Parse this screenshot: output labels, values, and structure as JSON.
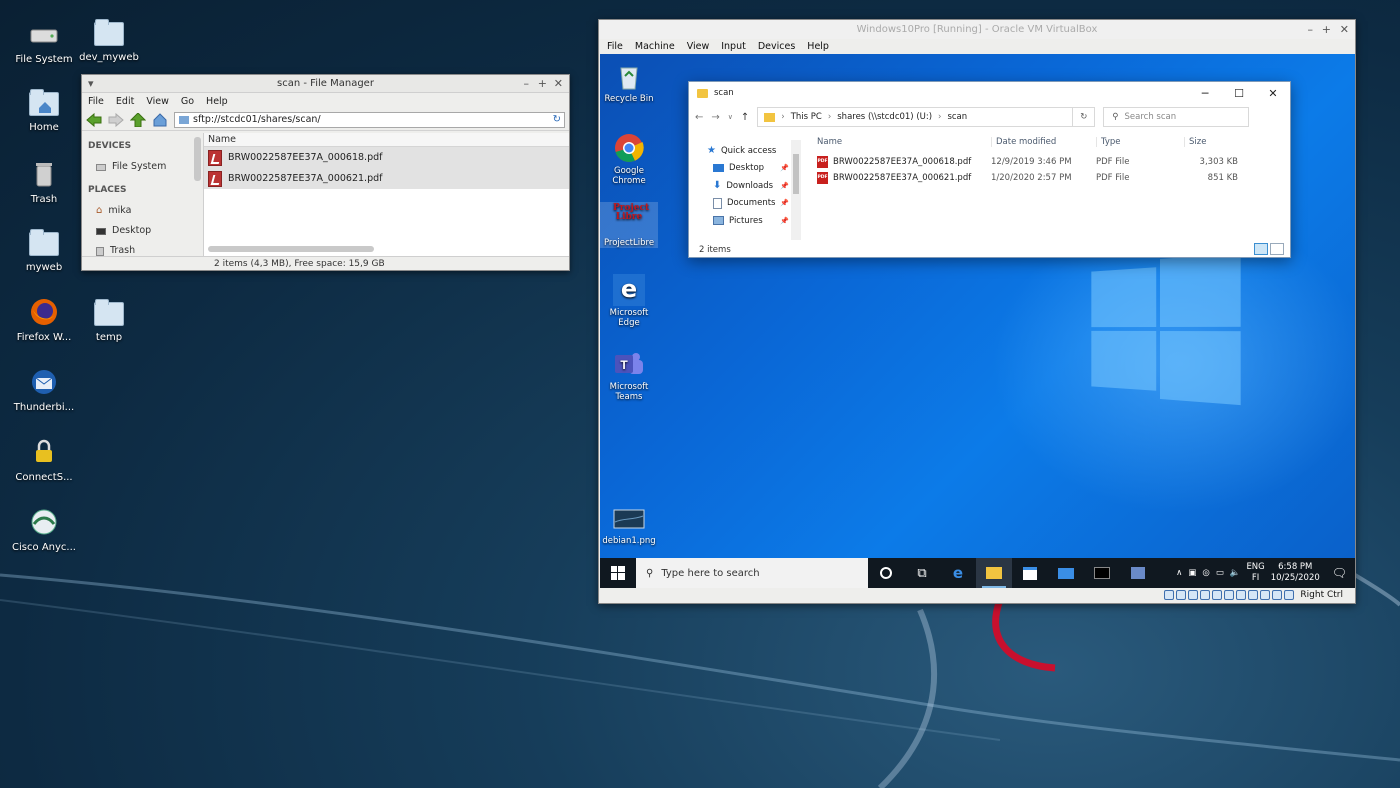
{
  "desktop": {
    "icons": [
      {
        "label": "File System",
        "icon": "drive-icon"
      },
      {
        "label": "dev_myweb",
        "icon": "folder-icon"
      },
      {
        "label": "Home",
        "icon": "home-folder-icon"
      },
      {
        "label": "Trash",
        "icon": "trash-icon"
      },
      {
        "label": "myweb",
        "icon": "folder-icon"
      },
      {
        "label": "Firefox W...",
        "icon": "firefox-icon"
      },
      {
        "label": "temp",
        "icon": "folder-icon"
      },
      {
        "label": "Thunderbi...",
        "icon": "thunderbird-icon"
      },
      {
        "label": "ConnectS...",
        "icon": "lock-icon"
      },
      {
        "label": "Cisco Anyc...",
        "icon": "globe-icon"
      }
    ]
  },
  "file_manager": {
    "title": "scan - File Manager",
    "menu": [
      "File",
      "Edit",
      "View",
      "Go",
      "Help"
    ],
    "path": "sftp://stcdc01/shares/scan/",
    "sidebar": {
      "devices_header": "DEVICES",
      "devices": [
        "File System"
      ],
      "places_header": "PLACES",
      "places": [
        "mika",
        "Desktop",
        "Trash"
      ]
    },
    "column_header": "Name",
    "files": [
      "BRW0022587EE37A_000618.pdf",
      "BRW0022587EE37A_000621.pdf"
    ],
    "status": "2 items (4,3 MB), Free space: 15,9 GB"
  },
  "virtualbox": {
    "title": "Windows10Pro [Running] - Oracle VM VirtualBox",
    "menu": [
      "File",
      "Machine",
      "View",
      "Input",
      "Devices",
      "Help"
    ],
    "host_key": "Right Ctrl",
    "guest": {
      "desktop_icons": [
        {
          "label": "Recycle Bin",
          "icon": "recycle-bin-icon"
        },
        {
          "label": "Google Chrome",
          "icon": "chrome-icon"
        },
        {
          "label": "ProjectLibre",
          "icon": "projectlibre-icon",
          "logo_text": "Project Libre"
        },
        {
          "label": "Microsoft Edge",
          "icon": "edge-icon"
        },
        {
          "label": "Microsoft Teams",
          "icon": "teams-icon"
        },
        {
          "label": "debian1.png",
          "icon": "image-file-icon"
        }
      ],
      "explorer": {
        "title": "scan",
        "breadcrumb": [
          "This PC",
          "shares (\\\\stcdc01) (U:)",
          "scan"
        ],
        "search_placeholder": "Search scan",
        "nav": [
          {
            "label": "Quick access",
            "icon": "star-icon"
          },
          {
            "label": "Desktop",
            "icon": "desktop-icon"
          },
          {
            "label": "Downloads",
            "icon": "download-icon"
          },
          {
            "label": "Documents",
            "icon": "documents-icon"
          },
          {
            "label": "Pictures",
            "icon": "pictures-icon"
          }
        ],
        "columns": [
          "Name",
          "Date modified",
          "Type",
          "Size"
        ],
        "files": [
          {
            "name": "BRW0022587EE37A_000618.pdf",
            "date": "12/9/2019 3:46 PM",
            "type": "PDF File",
            "size": "3,303 KB"
          },
          {
            "name": "BRW0022587EE37A_000621.pdf",
            "date": "1/20/2020 2:57 PM",
            "type": "PDF File",
            "size": "851 KB"
          }
        ],
        "status": "2 items"
      },
      "taskbar": {
        "search_placeholder": "Type here to search",
        "lang": "ENG",
        "locale": "FI",
        "time": "6:58 PM",
        "date": "10/25/2020"
      }
    }
  }
}
